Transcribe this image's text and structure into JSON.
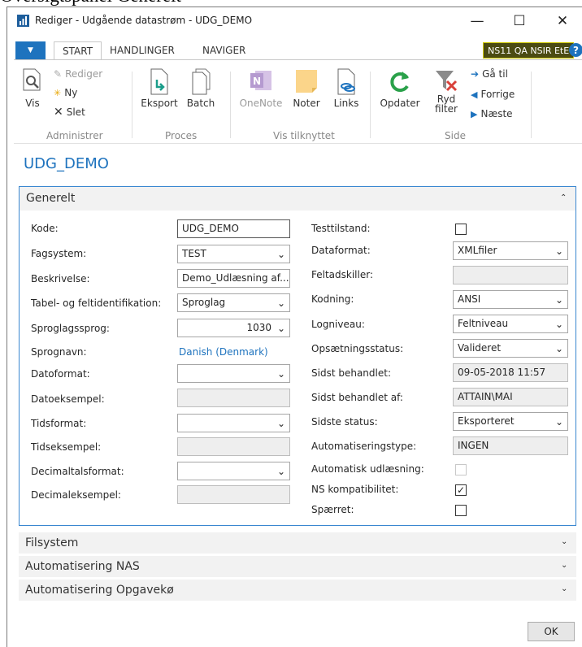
{
  "window": {
    "caption": "Oversigtspanel Generelt",
    "title": "Rediger - Udgående datastrøm - UDG_DEMO",
    "minimize": "—",
    "maximize": "☐",
    "close": "✕"
  },
  "tabs": {
    "menu": "▼",
    "items": [
      {
        "label": "START"
      },
      {
        "label": "HANDLINGER"
      },
      {
        "label": "NAVIGER"
      }
    ],
    "company": "NS11 QA NSIR EtE",
    "help": "?"
  },
  "ribbon": {
    "administrer": {
      "vis": "Vis",
      "rediger": "Rediger",
      "ny": "Ny",
      "slet": "Slet",
      "label": "Administrer"
    },
    "proces": {
      "eksport": "Eksport",
      "batch": "Batch",
      "label": "Proces"
    },
    "vis_tilknyttet": {
      "onenote": "OneNote",
      "noter": "Noter",
      "links": "Links",
      "label": "Vis tilknyttet"
    },
    "side": {
      "opdater": "Opdater",
      "ryd_filter_line1": "Ryd",
      "ryd_filter_line2": "filter",
      "ga_til": "Gå til",
      "forrige": "Forrige",
      "naeste": "Næste",
      "label": "Side"
    }
  },
  "page": {
    "title": "UDG_DEMO"
  },
  "generelt": {
    "header": "Generelt",
    "left": {
      "kode": {
        "label": "Kode:",
        "value": "UDG_DEMO"
      },
      "fagsystem": {
        "label": "Fagsystem:",
        "value": "TEST"
      },
      "beskrivelse": {
        "label": "Beskrivelse:",
        "value": "Demo_Udlæsning af..."
      },
      "tabel": {
        "label": "Tabel- og feltidentifikation:",
        "value": "Sproglag"
      },
      "sproglagssprog": {
        "label": "Sproglagssprog:",
        "value": "1030"
      },
      "sprognavn": {
        "label": "Sprognavn:",
        "value": "Danish (Denmark)"
      },
      "datoformat": {
        "label": "Datoformat:",
        "value": ""
      },
      "datoeksempel": {
        "label": "Datoeksempel:",
        "value": ""
      },
      "tidsformat": {
        "label": "Tidsformat:",
        "value": ""
      },
      "tidseksempel": {
        "label": "Tidseksempel:",
        "value": ""
      },
      "decimaltalsformat": {
        "label": "Decimaltalsformat:",
        "value": ""
      },
      "decimaleksempel": {
        "label": "Decimaleksempel:",
        "value": ""
      }
    },
    "right": {
      "testtilstand": {
        "label": "Testtilstand:",
        "checked": false
      },
      "dataformat": {
        "label": "Dataformat:",
        "value": "XMLfiler"
      },
      "feltadskiller": {
        "label": "Feltadskiller:",
        "value": ""
      },
      "kodning": {
        "label": "Kodning:",
        "value": "ANSI"
      },
      "logniveau": {
        "label": "Logniveau:",
        "value": "Feltniveau"
      },
      "opsaetningsstatus": {
        "label": "Opsætningsstatus:",
        "value": "Valideret"
      },
      "sidst_behandlet": {
        "label": "Sidst behandlet:",
        "value": "09-05-2018 11:57"
      },
      "sidst_behandlet_af": {
        "label": "Sidst behandlet af:",
        "value": "ATTAIN\\MAI"
      },
      "sidste_status": {
        "label": "Sidste status:",
        "value": "Eksporteret"
      },
      "automatiseringstype": {
        "label": "Automatiseringstype:",
        "value": "INGEN"
      },
      "automatisk_udlaesning": {
        "label": "Automatisk udlæsning:",
        "checked": false
      },
      "ns_kompatibilitet": {
        "label": "NS kompatibilitet:",
        "checked": true
      },
      "spaerret": {
        "label": "Spærret:",
        "checked": false
      }
    }
  },
  "fasttabs": [
    {
      "label": "Filsystem"
    },
    {
      "label": "Automatisering NAS"
    },
    {
      "label": "Automatisering Opgavekø"
    }
  ],
  "footer": {
    "ok": "OK"
  },
  "colors": {
    "accent": "#1e73be",
    "company_bg": "#4b4b12"
  }
}
